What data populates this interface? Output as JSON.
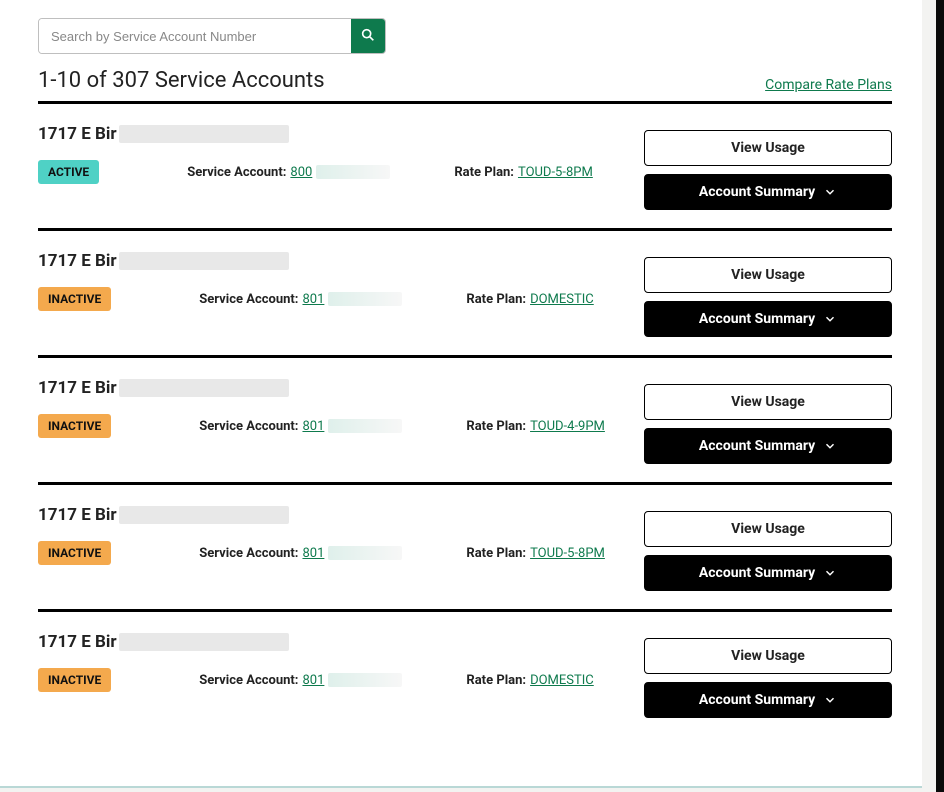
{
  "search": {
    "placeholder": "Search by Service Account Number"
  },
  "header": {
    "count_text": "1-10 of 307 Service Accounts",
    "compare_label": "Compare Rate Plans"
  },
  "labels": {
    "service_account": "Service Account:",
    "rate_plan": "Rate Plan:",
    "view_usage": "View Usage",
    "account_summary": "Account Summary"
  },
  "status_labels": {
    "ACTIVE": "ACTIVE",
    "INACTIVE": "INACTIVE"
  },
  "accounts": [
    {
      "address_prefix": "1717 E Bir",
      "status": "ACTIVE",
      "service_account_prefix": "800",
      "rate_plan": "TOUD-5-8PM"
    },
    {
      "address_prefix": "1717 E Bir",
      "status": "INACTIVE",
      "service_account_prefix": "801",
      "rate_plan": "DOMESTIC"
    },
    {
      "address_prefix": "1717 E Bir",
      "status": "INACTIVE",
      "service_account_prefix": "801",
      "rate_plan": "TOUD-4-9PM"
    },
    {
      "address_prefix": "1717 E Bir",
      "status": "INACTIVE",
      "service_account_prefix": "801",
      "rate_plan": "TOUD-5-8PM"
    },
    {
      "address_prefix": "1717 E Bir",
      "status": "INACTIVE",
      "service_account_prefix": "801",
      "rate_plan": "DOMESTIC"
    }
  ]
}
